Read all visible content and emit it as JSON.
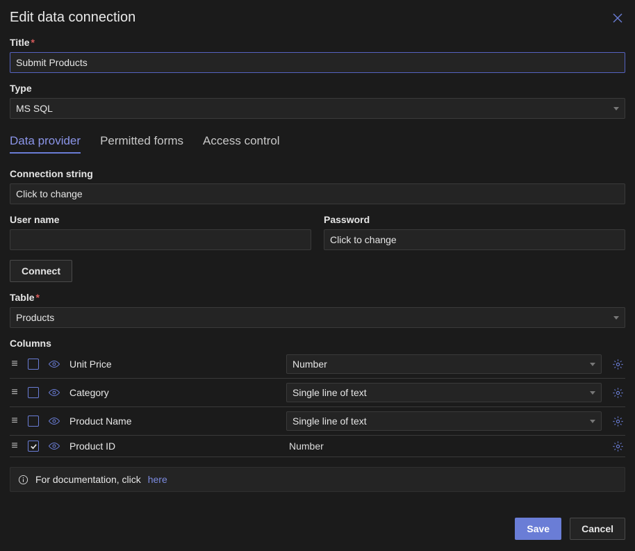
{
  "dialog": {
    "title": "Edit data connection"
  },
  "title_field": {
    "label": "Title",
    "value": "Submit Products"
  },
  "type_field": {
    "label": "Type",
    "value": "MS SQL"
  },
  "tabs": {
    "data_provider": "Data provider",
    "permitted_forms": "Permitted forms",
    "access_control": "Access control"
  },
  "connection_string": {
    "label": "Connection string",
    "value": "Click to change"
  },
  "username": {
    "label": "User name",
    "value": ""
  },
  "password": {
    "label": "Password",
    "value": "Click to change"
  },
  "connect": {
    "label": "Connect"
  },
  "table_field": {
    "label": "Table",
    "value": "Products"
  },
  "columns": {
    "label": "Columns",
    "rows": [
      {
        "name": "Unit Price",
        "type": "Number",
        "checked": false,
        "editable_type": true
      },
      {
        "name": "Category",
        "type": "Single line of text",
        "checked": false,
        "editable_type": true
      },
      {
        "name": "Product Name",
        "type": "Single line of text",
        "checked": false,
        "editable_type": true
      },
      {
        "name": "Product ID",
        "type": "Number",
        "checked": true,
        "editable_type": false
      }
    ]
  },
  "doc": {
    "text": "For documentation, click ",
    "link": "here"
  },
  "footer": {
    "save": "Save",
    "cancel": "Cancel"
  }
}
